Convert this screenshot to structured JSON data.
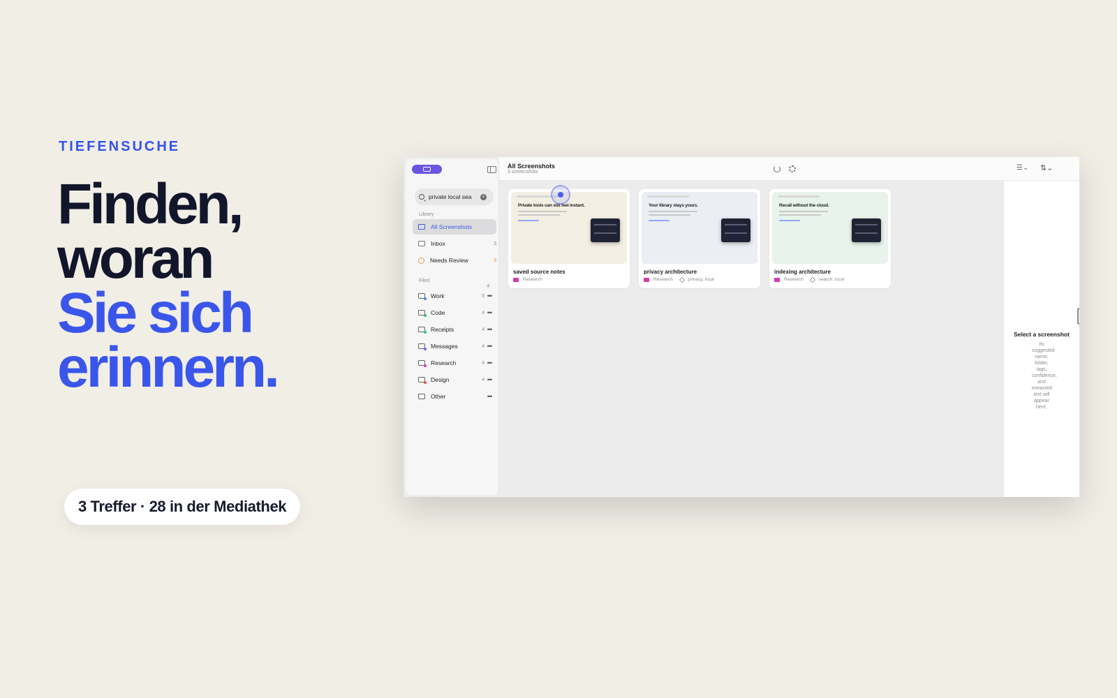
{
  "hero": {
    "eyebrow": "TIEFENSUCHE",
    "line1": "Finden,",
    "line2": "woran",
    "line3": "Sie sich",
    "line4": "erinnern.",
    "results_pill": "3 Treffer · 28 in der Mediathek"
  },
  "colors": {
    "background": "#f1eee6",
    "accent_blue": "#3a56ea",
    "headline_dark": "#12162b",
    "sidebar_badge": "#6a55e3",
    "folder_research": "#d43ab0"
  },
  "sidebar": {
    "search_value": "private local sea",
    "library_label": "Library",
    "filed_label": "Filed",
    "library_items": [
      {
        "label": "All Screenshots",
        "count": "",
        "icon": "grid-icon"
      },
      {
        "label": "Inbox",
        "count": "3",
        "icon": "tray-icon"
      },
      {
        "label": "Needs Review",
        "count": "3",
        "icon": "warning-icon"
      }
    ],
    "folders": [
      {
        "label": "Work",
        "count": "5"
      },
      {
        "label": "Code",
        "count": "4"
      },
      {
        "label": "Receipts",
        "count": "4"
      },
      {
        "label": "Messages",
        "count": "4"
      },
      {
        "label": "Research",
        "count": "4"
      },
      {
        "label": "Design",
        "count": "4"
      },
      {
        "label": "Other",
        "count": ""
      }
    ]
  },
  "toolbar": {
    "title": "All Screenshots",
    "subtitle": "3 screenshots",
    "filter_icon": "filter-icon",
    "sort_icon": "sort-icon"
  },
  "cards": [
    {
      "name": "saved source notes",
      "folder": "Research",
      "tags": "",
      "headline": "Private tools can still feel instant.",
      "bg": "#f4efe3"
    },
    {
      "name": "privacy architecture",
      "folder": "Research",
      "tags": "privacy, local",
      "headline": "Your library stays yours.",
      "bg": "#eceef5"
    },
    {
      "name": "indexing architecture",
      "folder": "Research",
      "tags": "search, local",
      "headline": "Recall without the cloud.",
      "bg": "#e8f3ec"
    }
  ],
  "inspector": {
    "title": "Select a screenshot",
    "description": "Its suggested name, folder, tags, confidence, and extracted text will appear here."
  }
}
